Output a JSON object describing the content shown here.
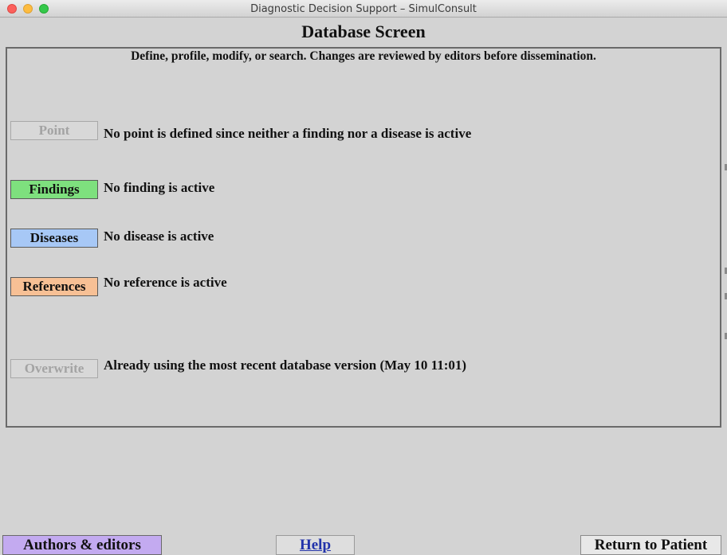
{
  "window": {
    "title": "Diagnostic Decision Support – SimulConsult"
  },
  "screen": {
    "title": "Database Screen",
    "subtitle": "Define, profile, modify, or search.  Changes are reviewed by editors before dissemination."
  },
  "rows": {
    "point": {
      "button_label": "Point",
      "status": "No point is defined since neither a finding nor a disease is active"
    },
    "findings": {
      "button_label": "Findings",
      "status": "No finding is active"
    },
    "diseases": {
      "button_label": "Diseases",
      "status": "No disease is active"
    },
    "references": {
      "button_label": "References",
      "status": "No reference is active"
    },
    "overwrite": {
      "button_label": "Overwrite",
      "status": "Already using the most recent database version (May 10 11:01)"
    }
  },
  "footer": {
    "authors_label": "Authors & editors",
    "help_label": "Help",
    "return_label": "Return to Patient"
  },
  "colors": {
    "findings": "#7ee07e",
    "diseases": "#a7c8f6",
    "references": "#f7c095",
    "authors": "#c3aaf0",
    "background": "#d3d3d3"
  }
}
